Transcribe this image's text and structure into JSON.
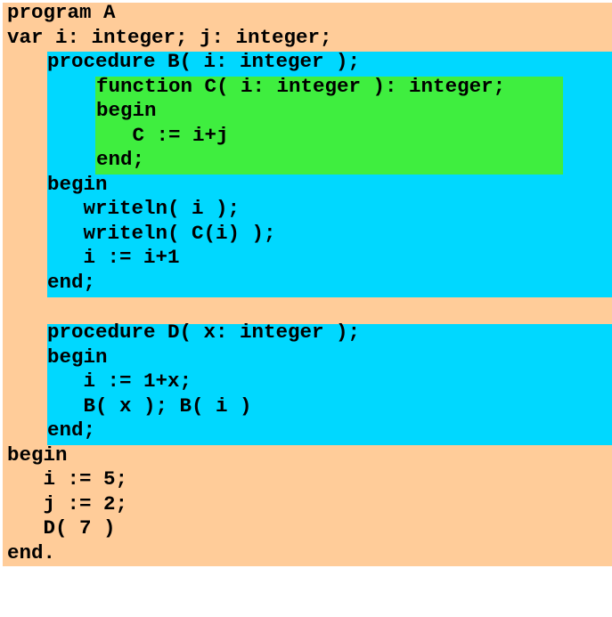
{
  "colors": {
    "outer_background": "#ffcc99",
    "procedure_block": "#00d8ff",
    "function_block": "#3fee3f",
    "text": "#000000"
  },
  "program": {
    "lines": [
      {
        "indent": 0,
        "text": "program A"
      },
      {
        "indent": 0,
        "text": "var i: integer; j: integer;"
      },
      {
        "indent": 1,
        "text": "procedure B( i: integer );"
      },
      {
        "indent": 2,
        "text": "function C( i: integer ): integer;"
      },
      {
        "indent": 2,
        "text": "begin"
      },
      {
        "indent": 2,
        "text": "   C := i+j"
      },
      {
        "indent": 2,
        "text": "end;"
      },
      {
        "indent": 1,
        "text": "begin"
      },
      {
        "indent": 1,
        "text": "   writeln( i );"
      },
      {
        "indent": 1,
        "text": "   writeln( C(i) );"
      },
      {
        "indent": 1,
        "text": "   i := i+1"
      },
      {
        "indent": 1,
        "text": "end;"
      },
      {
        "indent": 0,
        "text": ""
      },
      {
        "indent": 1,
        "text": "procedure D( x: integer );"
      },
      {
        "indent": 1,
        "text": "begin"
      },
      {
        "indent": 1,
        "text": "   i := 1+x;"
      },
      {
        "indent": 1,
        "text": "   B( x ); B( i )"
      },
      {
        "indent": 1,
        "text": "end;"
      },
      {
        "indent": 0,
        "text": "begin"
      },
      {
        "indent": 0,
        "text": "   i := 5;"
      },
      {
        "indent": 0,
        "text": "   j := 2;"
      },
      {
        "indent": 0,
        "text": "   D( 7 )"
      },
      {
        "indent": 0,
        "text": "end."
      }
    ]
  }
}
